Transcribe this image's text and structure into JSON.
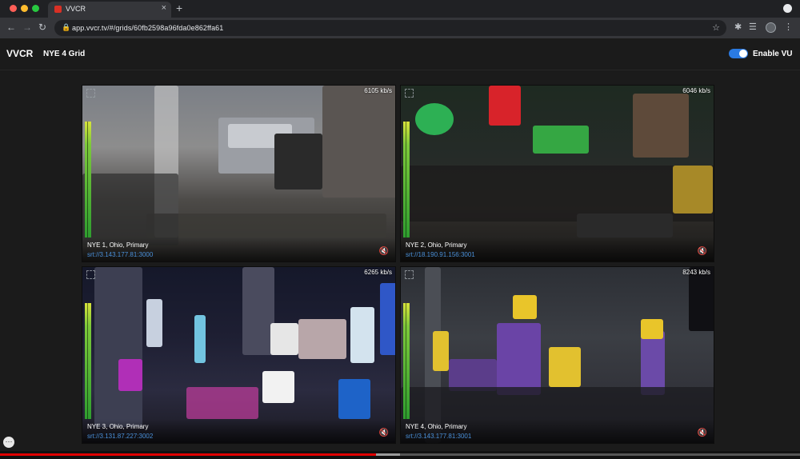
{
  "browser": {
    "tab_title": "VVCR",
    "tab_close": "×",
    "new_tab": "+",
    "url": "app.vvcr.tv/#/grids/60fb2598a96fda0e862ffa61",
    "icons": [
      "back-icon",
      "forward-icon",
      "reload-icon",
      "lock-icon",
      "star-icon",
      "extensions-icon",
      "media-icon",
      "profile-avatar",
      "menu-icon"
    ]
  },
  "app": {
    "logo": "VVCR",
    "grid_title": "NYE 4 Grid",
    "vu_toggle_label": "Enable VU",
    "vu_enabled": true,
    "accent_color": "#2a7ae2"
  },
  "tiles": [
    {
      "name": "NYE 1, Ohio, Primary",
      "url": "srt://3.143.177.81:3000",
      "bitrate": "6105 kb/s",
      "muted": true
    },
    {
      "name": "NYE 2, Ohio, Primary",
      "url": "srt://18.190.91.156:3001",
      "bitrate": "6046 kb/s",
      "muted": true
    },
    {
      "name": "NYE 3, Ohio, Primary",
      "url": "srt://3.131.87.227:3002",
      "bitrate": "6265 kb/s",
      "muted": true
    },
    {
      "name": "NYE 4, Ohio, Primary",
      "url": "srt://3.143.177.81:3001",
      "bitrate": "8243 kb/s",
      "muted": true
    }
  ],
  "player": {
    "progress": 0.47,
    "buffered": 0.5,
    "progress_color": "#e00000",
    "more_button": "⋯"
  }
}
